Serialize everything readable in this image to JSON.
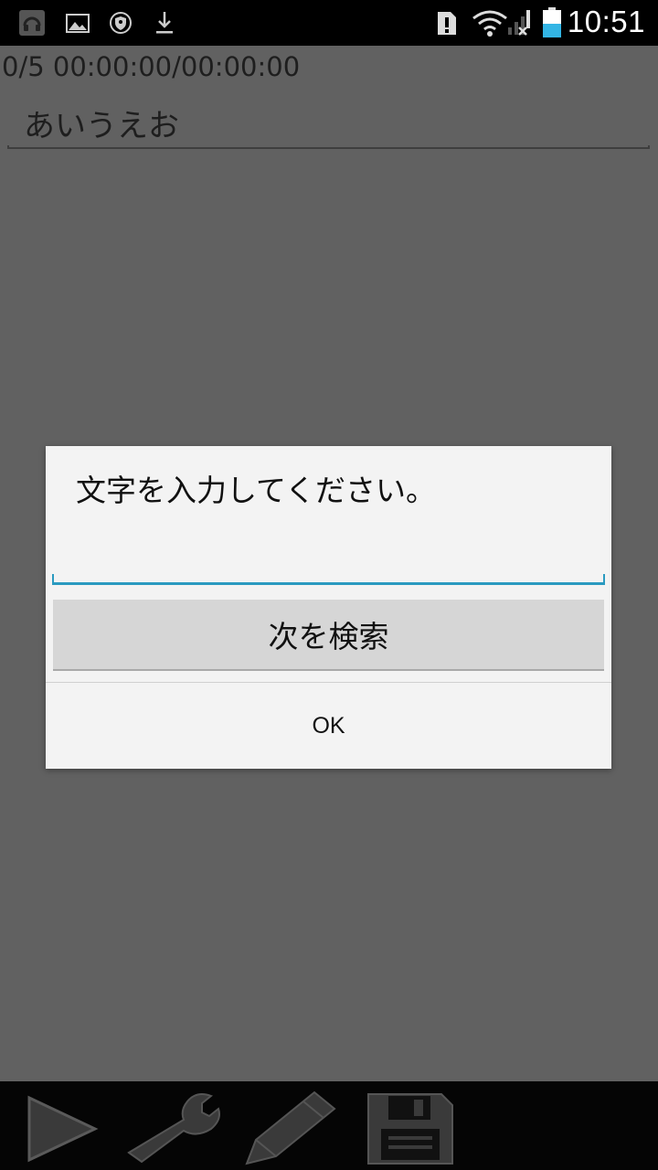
{
  "status_bar": {
    "time": "10:51",
    "left_icons": [
      "headset-icon",
      "image-icon",
      "shield-icon",
      "download-icon"
    ],
    "right_icons": [
      "alert-icon",
      "wifi-icon",
      "signal-icon",
      "battery-icon"
    ]
  },
  "main": {
    "counter": "0/5  00:00:00/00:00:00",
    "text_value": "あいうえお"
  },
  "dialog": {
    "prompt": "文字を入力してください。",
    "input_value": "",
    "search_button": "次を検索",
    "ok_button": "OK"
  },
  "toolbar": {
    "buttons": [
      "play-icon",
      "wrench-icon",
      "pencil-icon",
      "save-icon"
    ]
  },
  "colors": {
    "accent": "#2a9ac0",
    "battery_fill": "#33b5e5",
    "dim_background": "#616161"
  }
}
